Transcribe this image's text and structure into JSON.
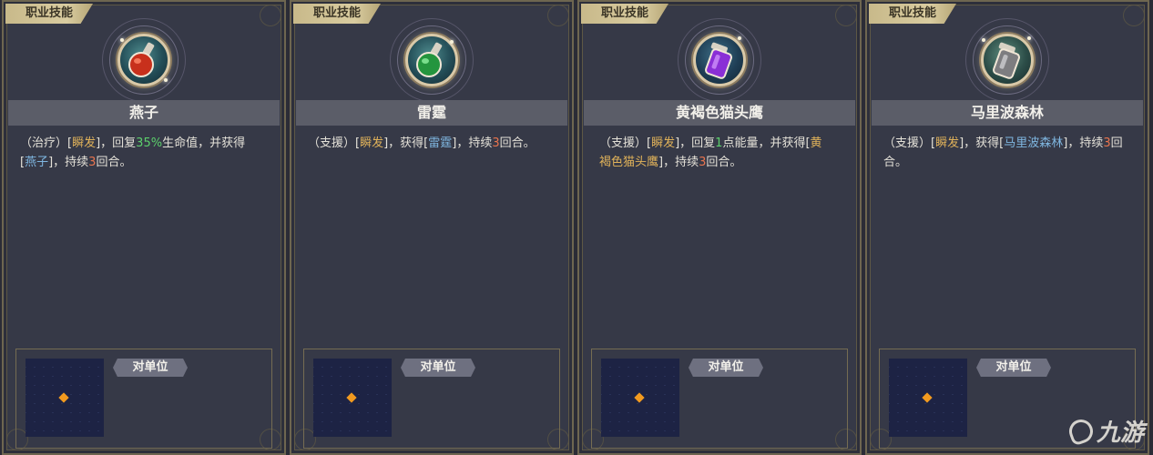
{
  "section_tag": "职业技能",
  "target_label": "对单位",
  "watermark": "九游",
  "colors": {
    "tag_bg": "#d9cca0",
    "card_bg": "#363947",
    "namebar_bg": "#5b5d68",
    "text_highlight_yellow": "#e0b25a",
    "text_highlight_green": "#5cd06c",
    "text_highlight_blue": "#7fb6e0",
    "text_highlight_red": "#e8744e",
    "range_marker": "#f29a1f"
  },
  "cards": [
    {
      "name": "燕子",
      "icon": "red-potion-flask-icon",
      "potion_color": "#d23a22",
      "desc": {
        "p1": "（治疗）[",
        "instant": "瞬发",
        "p2": "]，回复",
        "value": "35%",
        "p3": "生命值，并获得",
        "p4": "[",
        "buff": "燕子",
        "p5": "]，持续",
        "turns": "3",
        "p6": "回合。"
      }
    },
    {
      "name": "雷霆",
      "icon": "green-potion-flask-icon",
      "potion_color": "#2fa247",
      "desc": {
        "p1": "（支援）[",
        "instant": "瞬发",
        "p2": "]，获得[",
        "buff": "雷霆",
        "p3": "]，持续",
        "turns": "3",
        "p4": "回合。"
      }
    },
    {
      "name": "黄褐色猫头鹰",
      "icon": "purple-potion-jar-icon",
      "potion_color": "#8a2fd6",
      "desc": {
        "p1": "（支援）[",
        "instant": "瞬发",
        "p2": "]，回复",
        "value": "1",
        "p3": "点能量，并获得[",
        "buff_a": "黄",
        "buff_b": "褐色猫头鹰",
        "p4": "]，持续",
        "turns": "3",
        "p5": "回合。"
      }
    },
    {
      "name": "马里波森林",
      "icon": "silver-potion-jar-icon",
      "potion_color": "#8d8d8d",
      "desc": {
        "p1": "（支援）[",
        "instant": "瞬发",
        "p2": "]，获得[",
        "buff": "马里波森林",
        "p3": "]，持续",
        "turns": "3",
        "p4": "回合。"
      }
    }
  ]
}
